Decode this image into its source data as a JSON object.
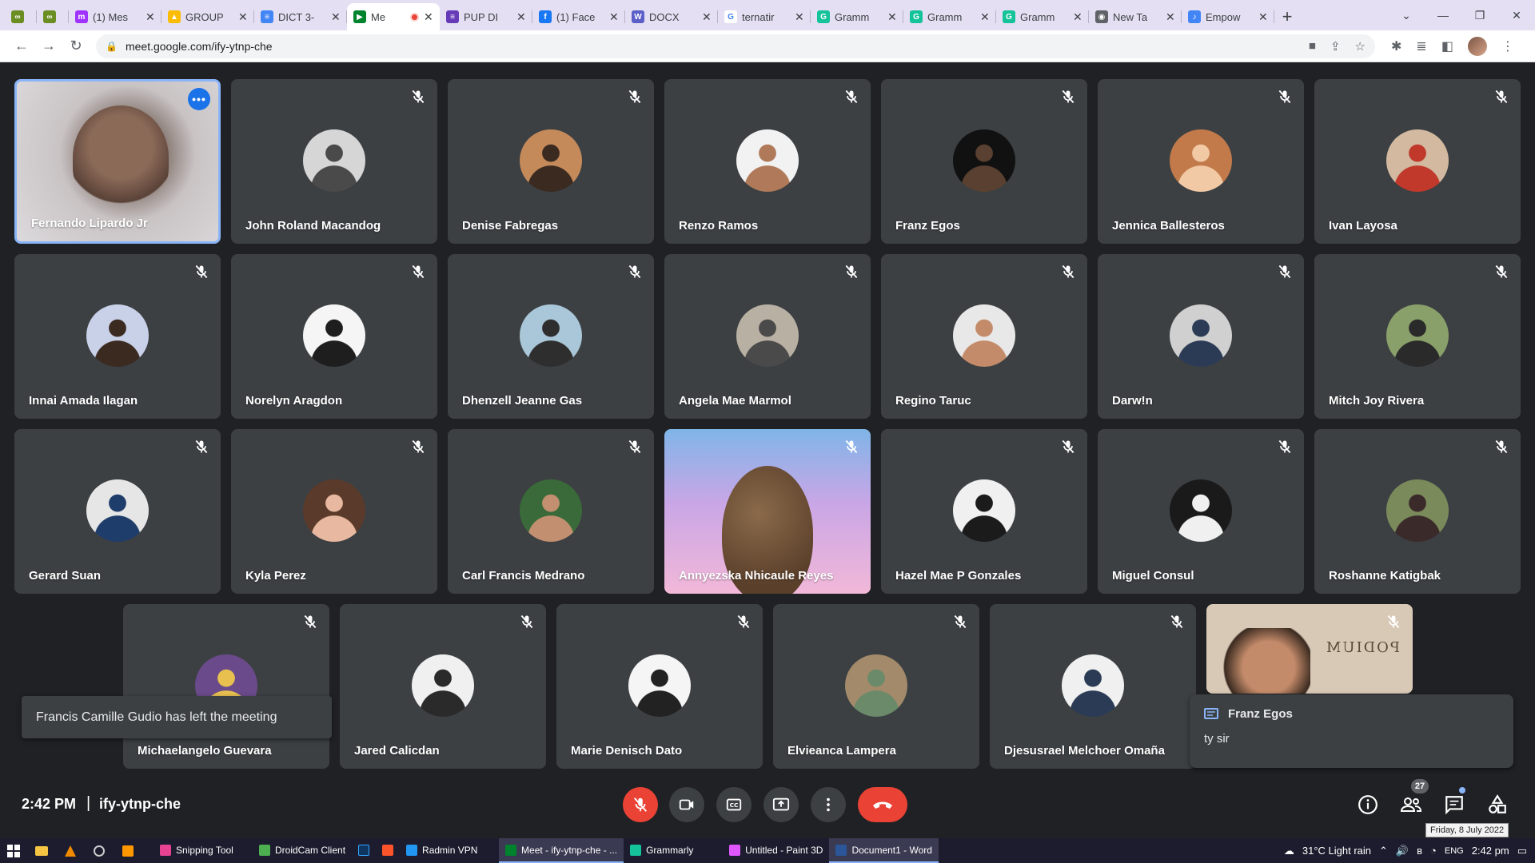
{
  "browser": {
    "tabs": [
      {
        "label": "",
        "fav": "#6b8e23",
        "glyph": "∞",
        "small": true
      },
      {
        "label": "",
        "fav": "#6b8e23",
        "glyph": "∞",
        "small": true
      },
      {
        "label": "(1) Mes",
        "fav": "#a033ff",
        "glyph": "m"
      },
      {
        "label": "GROUP",
        "fav": "#fbbc04",
        "glyph": "▲"
      },
      {
        "label": "DICT 3-",
        "fav": "#4285f4",
        "glyph": "≡"
      },
      {
        "label": "Me",
        "fav": "#00832d",
        "glyph": "▶",
        "active": true,
        "recording": true
      },
      {
        "label": "PUP DI",
        "fav": "#673ab7",
        "glyph": "≡"
      },
      {
        "label": "(1) Face",
        "fav": "#1877f2",
        "glyph": "f"
      },
      {
        "label": "DOCX",
        "fav": "#5b5fc7",
        "glyph": "W"
      },
      {
        "label": "ternatir",
        "fav": "#ffffff",
        "glyph": "G"
      },
      {
        "label": "Gramm",
        "fav": "#15c39a",
        "glyph": "G"
      },
      {
        "label": "Gramm",
        "fav": "#15c39a",
        "glyph": "G"
      },
      {
        "label": "Gramm",
        "fav": "#15c39a",
        "glyph": "G"
      },
      {
        "label": "New Ta",
        "fav": "#5f6368",
        "glyph": "◉"
      },
      {
        "label": "Empow",
        "fav": "#4285f4",
        "glyph": "♪"
      }
    ],
    "url": "meet.google.com/ify-ytnp-che"
  },
  "participants": [
    {
      "name": "Fernando Lipardo Jr",
      "video": true,
      "speaking": true
    },
    {
      "name": "John Roland Macandog",
      "tone": [
        "#d6d6d6",
        "#4a4a4a"
      ]
    },
    {
      "name": "Denise Fabregas",
      "tone": [
        "#c58a5a",
        "#3a2a1f"
      ]
    },
    {
      "name": "Renzo Ramos",
      "tone": [
        "#f2f2f2",
        "#b07a5a"
      ]
    },
    {
      "name": "Franz Egos",
      "tone": [
        "#111111",
        "#5a4030"
      ]
    },
    {
      "name": "Jennica Ballesteros",
      "tone": [
        "#c27a4a",
        "#f2c9a5"
      ]
    },
    {
      "name": "Ivan Layosa",
      "tone": [
        "#d2b9a0",
        "#c0392b"
      ]
    },
    {
      "name": "Innai Amada Ilagan",
      "tone": [
        "#c9d1e8",
        "#3b2a20"
      ]
    },
    {
      "name": "Norelyn Aragdon",
      "tone": [
        "#f5f5f5",
        "#1e1e1e"
      ]
    },
    {
      "name": "Dhenzell Jeanne Gas",
      "tone": [
        "#a9c7d8",
        "#2e2e2e"
      ]
    },
    {
      "name": "Angela Mae Marmol",
      "tone": [
        "#b8b0a3",
        "#4a4a4a"
      ]
    },
    {
      "name": "Regino Taruc",
      "tone": [
        "#e8e8e8",
        "#c48b6a"
      ]
    },
    {
      "name": "Darw!n",
      "tone": [
        "#d0d0d0",
        "#2b3b55"
      ]
    },
    {
      "name": "Mitch Joy Rivera",
      "tone": [
        "#8aa06a",
        "#2a2a2a"
      ]
    },
    {
      "name": "Gerard Suan",
      "tone": [
        "#e6e6e6",
        "#1f3d6b"
      ]
    },
    {
      "name": "Kyla Perez",
      "tone": [
        "#5a3a2a",
        "#e8b9a0"
      ]
    },
    {
      "name": "Carl Francis Medrano",
      "tone": [
        "#3a6a3a",
        "#c29070"
      ]
    },
    {
      "name": "Annyezska Nhicaule Reyes",
      "video": true,
      "cloud": true
    },
    {
      "name": "Hazel Mae P Gonzales",
      "tone": [
        "#f0f0f0",
        "#1b1b1b"
      ]
    },
    {
      "name": "Miguel Consul",
      "tone": [
        "#1a1a1a",
        "#f0f0f0"
      ]
    },
    {
      "name": "Roshanne Katigbak",
      "tone": [
        "#7a8a5a",
        "#3a2a2a"
      ]
    },
    {
      "name": "Michaelangelo Guevara",
      "tone": [
        "#6a4a8a",
        "#e8c050"
      ]
    },
    {
      "name": "Jared Calicdan",
      "tone": [
        "#f0f0f0",
        "#2a2a2a"
      ]
    },
    {
      "name": "Marie Denisch Dato",
      "tone": [
        "#f5f5f5",
        "#222222"
      ]
    },
    {
      "name": "Elvieanca Lampera",
      "tone": [
        "#a38a6a",
        "#6a8a6a"
      ]
    },
    {
      "name": "Djesusrael Melchoer Omaña",
      "tone": [
        "#f0f0f0",
        "#2b3b55"
      ]
    },
    {
      "name": "",
      "video": true,
      "podium": true
    }
  ],
  "podium_text": "PODIUM",
  "toast": "Francis Camille Gudio has left the meeting",
  "chat_popup": {
    "sender": "Franz Egos",
    "message": "ty sir"
  },
  "meeting": {
    "time": "2:42 PM",
    "separator": "|",
    "code": "ify-ytnp-che",
    "people_count": "27"
  },
  "colors": {
    "accent": "#1a73e8",
    "end_call": "#ea4335",
    "tile": "#3c4043",
    "background": "#202124"
  },
  "taskbar": {
    "apps": [
      {
        "label": "Snipping Tool",
        "color": "#e84393"
      },
      {
        "label": "DroidCam Client",
        "color": "#4caf50"
      },
      {
        "label": "",
        "color": "#0f3460",
        "ps": true
      },
      {
        "label": "",
        "color": "#fb542b"
      },
      {
        "label": "Radmin VPN",
        "color": "#2196f3"
      },
      {
        "label": "Meet - ify-ytnp-che - ...",
        "color": "#00832d",
        "active": true
      },
      {
        "label": "Grammarly",
        "color": "#15c39a"
      },
      {
        "label": "Untitled - Paint 3D",
        "color": "#e056fd"
      },
      {
        "label": "Document1 - Word",
        "color": "#2b579a",
        "active": true
      }
    ],
    "weather": "31°C  Light rain",
    "lang": "ENG",
    "time": "2:42 pm",
    "date_tooltip": "Friday, 8 July 2022"
  }
}
